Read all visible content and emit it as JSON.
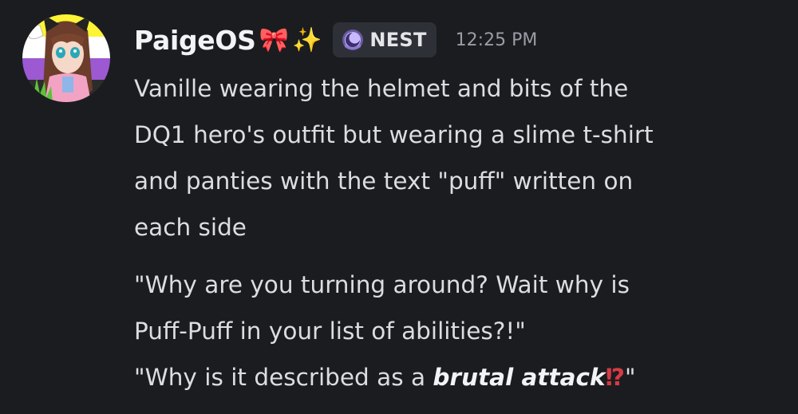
{
  "message": {
    "author": "PaigeOS",
    "name_emojis": [
      "🎀",
      "✨"
    ],
    "guild_tag": {
      "icon": "moon-nest-icon",
      "label": "NEST"
    },
    "timestamp": "12:25 PM",
    "avatar": {
      "icon": "user-avatar-image",
      "flag_colors": [
        "#fcf434",
        "#ffffff",
        "#9c59d1",
        "#2c2c2c"
      ]
    },
    "paragraph_1": [
      "Vanille wearing the helmet and bits of the",
      "DQ1 hero's outfit but wearing a slime t-shirt",
      "and panties with the text \"puff\" written on",
      "each side"
    ],
    "paragraph_2": [
      "\"Why are you turning around? Wait why is",
      "Puff-Puff in your list of abilities?!\""
    ],
    "paragraph_3": {
      "prefix": "\"Why is it described as a ",
      "emphasis": "brutal attack",
      "emoji": "⁉",
      "suffix": "\""
    }
  }
}
